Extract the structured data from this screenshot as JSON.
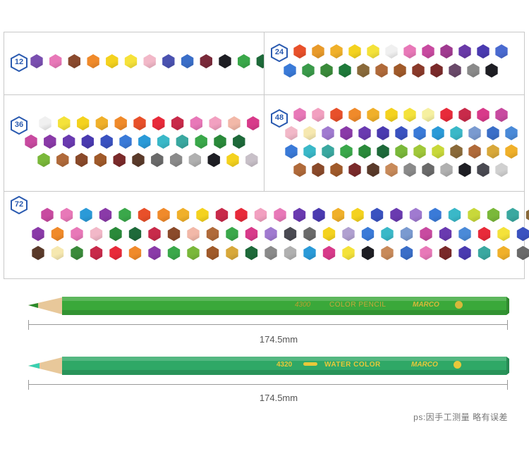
{
  "panels": [
    {
      "badge": "12",
      "rows": [
        [
          "#7a4fb0",
          "#e878b8",
          "#8a4a2e",
          "#f08a2a",
          "#f4d21e",
          "#f6e23a",
          "#f2b8c8",
          "#4a52b0",
          "#3a6ec8",
          "#7a2a3a",
          "#1e1e24",
          "#3aa84a",
          "#1e6a3a"
        ]
      ]
    },
    {
      "badge": "24",
      "rows": [
        [
          "#e8502a",
          "#e89a2a",
          "#f0b02a",
          "#f4d21e",
          "#f4e23a",
          "#f0f0f0",
          "#e878b8",
          "#c84aa0",
          "#a03a90",
          "#6a3aa8",
          "#4a3ab0",
          "#4a6ad0"
        ],
        [
          "#3a7ad8",
          "#3a9a4a",
          "#3a8a3a",
          "#1e7a3a",
          "#8a6a3a",
          "#b06a3a",
          "#a05a2a",
          "#8a3a2a",
          "#7a2a2a",
          "#6a4a6a",
          "#8a8a8a",
          "#1e1e24"
        ]
      ]
    },
    {
      "badge": "36",
      "rows": [
        [
          "#f0f0f0",
          "#f4e23a",
          "#f4d21e",
          "#f0b02a",
          "#f08a2a",
          "#e8502a",
          "#e82a3a",
          "#c82a4a",
          "#e878b8",
          "#f2a0c0",
          "#f2b8a8",
          "#d83a8a"
        ],
        [
          "#c84aa0",
          "#8a3aa8",
          "#6a3ab0",
          "#4a3ab0",
          "#3a52c0",
          "#3a7ad8",
          "#2a9ad8",
          "#3ab8c8",
          "#3aa8a0",
          "#3aa84a",
          "#2a8a3a",
          "#1e6a3a"
        ],
        [
          "#7ab83a",
          "#b06a3a",
          "#8a4a2a",
          "#a05a2a",
          "#7a2a2a",
          "#5a3a2a",
          "#6a6a6a",
          "#8a8a8a",
          "#b0b0b0",
          "#1e1e24",
          "#f4d21e",
          "#c8c0c8"
        ]
      ]
    },
    {
      "badge": "48",
      "rows": [
        [
          "#e878b8",
          "#f2a0c0",
          "#e8502a",
          "#f08a2a",
          "#f0b02a",
          "#f4d21e",
          "#f4e23a",
          "#f6f0a0",
          "#e82a3a",
          "#c82a4a",
          "#d83a8a",
          "#c84aa0"
        ],
        [
          "#f2b8c8",
          "#f6e8b0",
          "#a07ad0",
          "#8a3aa8",
          "#6a3ab0",
          "#4a3ab0",
          "#3a52c0",
          "#3a7ad8",
          "#2a9ad8",
          "#3ab8c8",
          "#7a9ad0",
          "#3a6ec8",
          "#4a8ad8"
        ],
        [
          "#3a7ad8",
          "#3ab8c8",
          "#3aa8a0",
          "#3aa84a",
          "#2a8a3a",
          "#1e6a3a",
          "#7ab83a",
          "#a0c83a",
          "#c8d83a",
          "#8a6a3a",
          "#b06a3a",
          "#d8a83a",
          "#f0b02a"
        ],
        [
          "#b06a3a",
          "#8a4a2a",
          "#a05a2a",
          "#7a2a2a",
          "#5a3a2a",
          "#c88a5a",
          "#8a8a8a",
          "#6a6a6a",
          "#b0b0b0",
          "#1e1e24",
          "#4a4a52",
          "#d0d0d0"
        ]
      ]
    },
    {
      "badge": "72",
      "rows": [
        [
          "#c84aa0",
          "#e878b8",
          "#2a9ad8",
          "#8a3aa8",
          "#3aa84a",
          "#e8502a",
          "#f08a2a",
          "#f0b02a",
          "#f4d21e",
          "#c82a4a",
          "#e82a3a",
          "#f2a0c0",
          "#e878b8",
          "#6a3ab0",
          "#4a3ab0",
          "#f0b02a",
          "#f4d21e",
          "#3a52c0",
          "#6a3ab0",
          "#a07ad0",
          "#3a7ad8",
          "#3ab8c8",
          "#c8d83a",
          "#7ab83a",
          "#3aa8a0",
          "#8a6a3a"
        ],
        [
          "#8a3aa8",
          "#f08a2a",
          "#e878b8",
          "#f2b8c8",
          "#2a8a3a",
          "#1e6a3a",
          "#c82a4a",
          "#8a4a2a",
          "#f2b8a8",
          "#b06a3a",
          "#3aa84a",
          "#d83a8a",
          "#a07ad0",
          "#4a4a52",
          "#6a6a6a",
          "#f4d21e",
          "#b0a0d0",
          "#3a7ad8",
          "#3ab8c8",
          "#7a9ad0",
          "#c84aa0",
          "#6a3ab0",
          "#4a8ad8",
          "#e82a3a",
          "#f4e23a",
          "#3a52c0"
        ],
        [
          "#5a3a2a",
          "#f6e8b0",
          "#3a8a3a",
          "#c82a4a",
          "#e82a3a",
          "#f08a2a",
          "#8a3aa8",
          "#3aa84a",
          "#7ab83a",
          "#a05a2a",
          "#d8a83a",
          "#1e6a3a",
          "#8a8a8a",
          "#b0b0b0",
          "#2a9ad8",
          "#d83a8a",
          "#f4e23a",
          "#1e1e24",
          "#c88a5a",
          "#3a6ec8",
          "#e878b8",
          "#7a2a2a",
          "#4a3ab0",
          "#3aa8a0",
          "#f0b02a",
          "#6a6a6a"
        ]
      ]
    }
  ],
  "pencils": [
    {
      "code": "4300",
      "label": "COLOR PENCIL",
      "brand": "MARCO",
      "length": "174.5mm",
      "body_color": "#3aa83a",
      "tip_color": "#2a8a2a"
    },
    {
      "code": "4320",
      "label": "WATER COLOR",
      "brand": "MARCO",
      "length": "174.5mm",
      "body_color": "#2fa866",
      "tip_color": "#3ad0b0"
    }
  ],
  "note": "ps:因手工测量 略有误差"
}
